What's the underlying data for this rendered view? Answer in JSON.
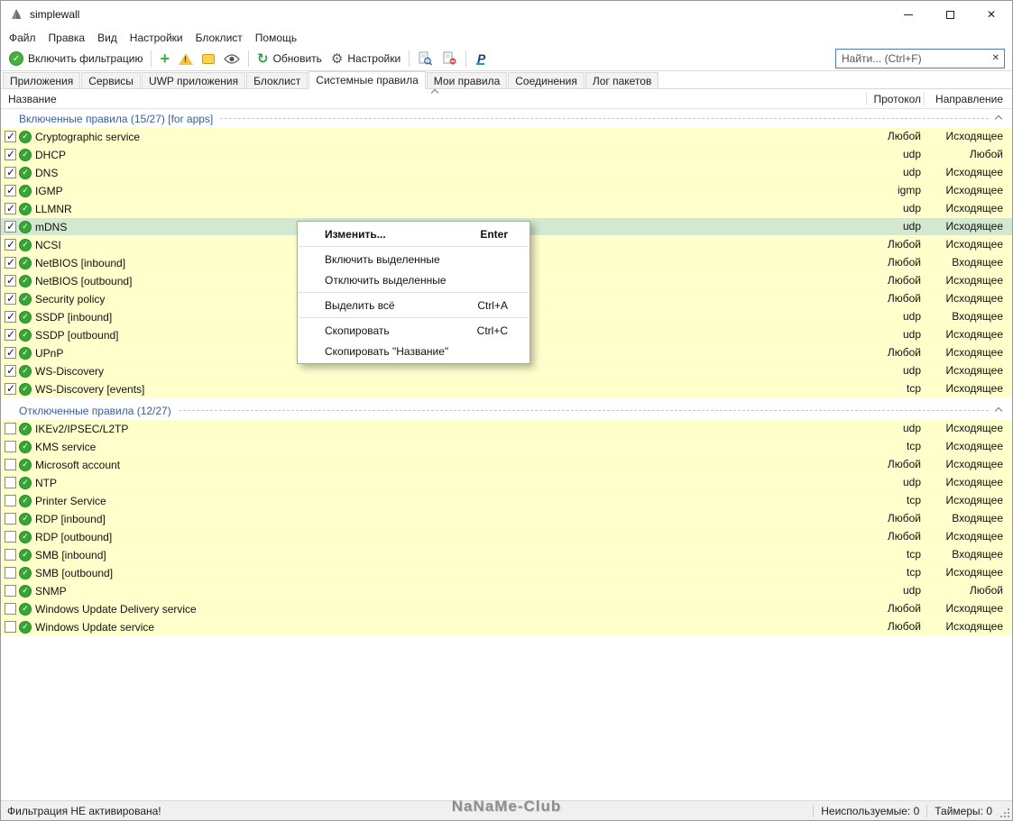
{
  "window": {
    "title": "simplewall"
  },
  "menubar": {
    "items": [
      "Файл",
      "Правка",
      "Вид",
      "Настройки",
      "Блоклист",
      "Помощь"
    ]
  },
  "toolbar": {
    "enable_filtering": "Включить фильтрацию",
    "refresh": "Обновить",
    "settings": "Настройки",
    "search_placeholder": "Найти... (Ctrl+F)"
  },
  "tabs": [
    "Приложения",
    "Сервисы",
    "UWP приложения",
    "Блоклист",
    "Системные правила",
    "Мои правила",
    "Соединения",
    "Лог пакетов"
  ],
  "active_tab_index": 4,
  "columns": [
    "Название",
    "Протокол",
    "Направление"
  ],
  "groups": [
    {
      "label": "Включенные правила (15/27) [for apps]",
      "checked": true,
      "rules": [
        {
          "name": "Cryptographic service",
          "protocol": "Любой",
          "direction": "Исходящее"
        },
        {
          "name": "DHCP",
          "protocol": "udp",
          "direction": "Любой"
        },
        {
          "name": "DNS",
          "protocol": "udp",
          "direction": "Исходящее"
        },
        {
          "name": "IGMP",
          "protocol": "igmp",
          "direction": "Исходящее"
        },
        {
          "name": "LLMNR",
          "protocol": "udp",
          "direction": "Исходящее"
        },
        {
          "name": "mDNS",
          "protocol": "udp",
          "direction": "Исходящее",
          "selected": true
        },
        {
          "name": "NCSI",
          "protocol": "Любой",
          "direction": "Исходящее"
        },
        {
          "name": "NetBIOS [inbound]",
          "protocol": "Любой",
          "direction": "Входящее"
        },
        {
          "name": "NetBIOS [outbound]",
          "protocol": "Любой",
          "direction": "Исходящее"
        },
        {
          "name": "Security policy",
          "protocol": "Любой",
          "direction": "Исходящее"
        },
        {
          "name": "SSDP [inbound]",
          "protocol": "udp",
          "direction": "Входящее"
        },
        {
          "name": "SSDP [outbound]",
          "protocol": "udp",
          "direction": "Исходящее"
        },
        {
          "name": "UPnP",
          "protocol": "Любой",
          "direction": "Исходящее"
        },
        {
          "name": "WS-Discovery",
          "protocol": "udp",
          "direction": "Исходящее"
        },
        {
          "name": "WS-Discovery [events]",
          "protocol": "tcp",
          "direction": "Исходящее"
        }
      ]
    },
    {
      "label": "Отключенные правила (12/27)",
      "checked": false,
      "rules": [
        {
          "name": "IKEv2/IPSEC/L2TP",
          "protocol": "udp",
          "direction": "Исходящее"
        },
        {
          "name": "KMS service",
          "protocol": "tcp",
          "direction": "Исходящее"
        },
        {
          "name": "Microsoft account",
          "protocol": "Любой",
          "direction": "Исходящее"
        },
        {
          "name": "NTP",
          "protocol": "udp",
          "direction": "Исходящее"
        },
        {
          "name": "Printer Service",
          "protocol": "tcp",
          "direction": "Исходящее"
        },
        {
          "name": "RDP [inbound]",
          "protocol": "Любой",
          "direction": "Входящее"
        },
        {
          "name": "RDP [outbound]",
          "protocol": "Любой",
          "direction": "Исходящее"
        },
        {
          "name": "SMB [inbound]",
          "protocol": "tcp",
          "direction": "Входящее"
        },
        {
          "name": "SMB [outbound]",
          "protocol": "tcp",
          "direction": "Исходящее"
        },
        {
          "name": "SNMP",
          "protocol": "udp",
          "direction": "Любой"
        },
        {
          "name": "Windows Update Delivery service",
          "protocol": "Любой",
          "direction": "Исходящее"
        },
        {
          "name": "Windows Update service",
          "protocol": "Любой",
          "direction": "Исходящее"
        }
      ]
    }
  ],
  "context_menu": {
    "items": [
      {
        "label": "Изменить...",
        "shortcut": "Enter",
        "bold": true
      },
      {
        "separator": true
      },
      {
        "label": "Включить выделенные"
      },
      {
        "label": "Отключить выделенные"
      },
      {
        "separator": true
      },
      {
        "label": "Выделить всё",
        "shortcut": "Ctrl+A"
      },
      {
        "separator": true
      },
      {
        "label": "Скопировать",
        "shortcut": "Ctrl+C"
      },
      {
        "label": "Скопировать \"Название\""
      }
    ]
  },
  "statusbar": {
    "left": "Фильтрация НЕ активирована!",
    "watermark": "NaNaMe-Club",
    "unused": "Неиспользуемые: 0",
    "timers": "Таймеры: 0"
  },
  "colors": {
    "row_highlight": "#ffffcc",
    "selected_row": "#d2e8cf",
    "group_text": "#33619e",
    "accent_green": "#3fae3f"
  }
}
